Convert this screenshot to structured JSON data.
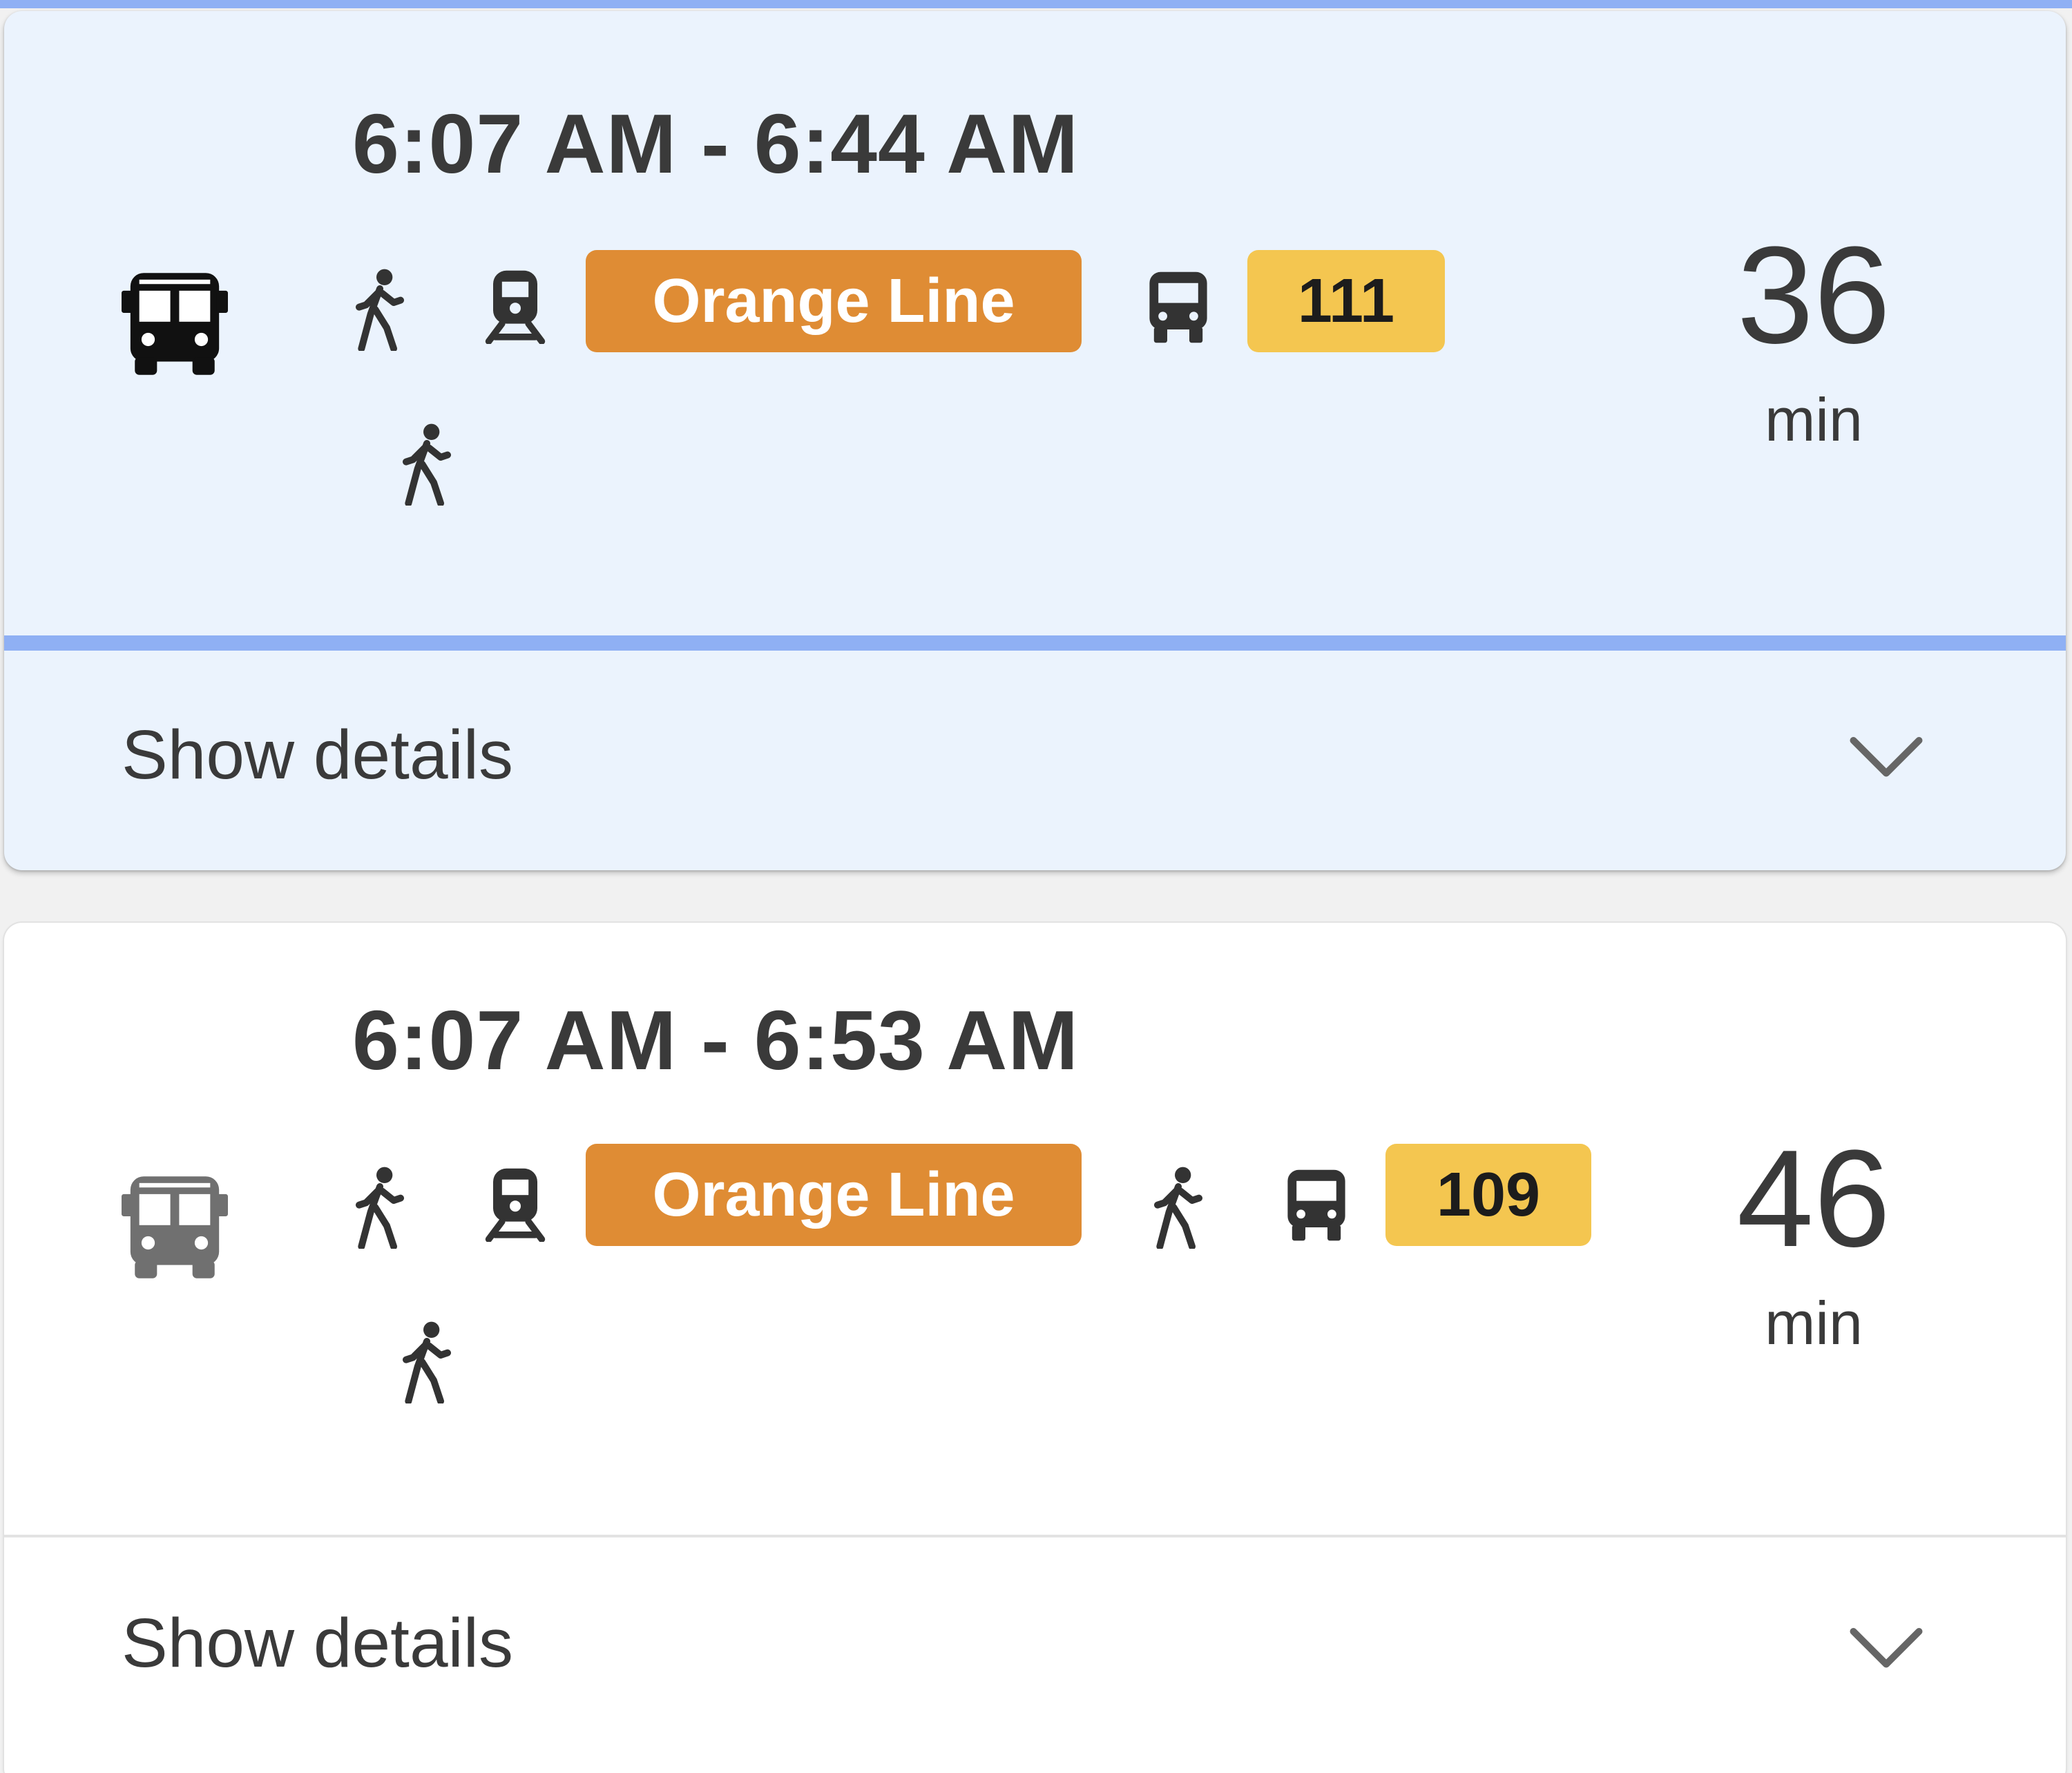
{
  "colors": {
    "accent": "#8fb0f4",
    "selected_card_bg": "#ebf3fd",
    "orange_line": "#df8c34",
    "bus_route": "#f4c650",
    "text": "#3a3a3a"
  },
  "trips": [
    {
      "time_range": "6:07 AM - 6:44 AM",
      "selected": true,
      "mode_icon": "bus-icon",
      "steps": [
        "walk-icon",
        "train-icon",
        "Orange Line",
        "bus-icon",
        "111",
        "walk-icon"
      ],
      "line_badge": "Orange Line",
      "route_badge": "111",
      "duration_value": "36",
      "duration_unit": "min",
      "details_label": "Show details"
    },
    {
      "time_range": "6:07 AM - 6:53 AM",
      "selected": false,
      "mode_icon": "bus-icon",
      "steps": [
        "walk-icon",
        "train-icon",
        "Orange Line",
        "walk-icon",
        "bus-icon",
        "109",
        "walk-icon"
      ],
      "line_badge": "Orange Line",
      "route_badge": "109",
      "duration_value": "46",
      "duration_unit": "min",
      "details_label": "Show details"
    }
  ]
}
